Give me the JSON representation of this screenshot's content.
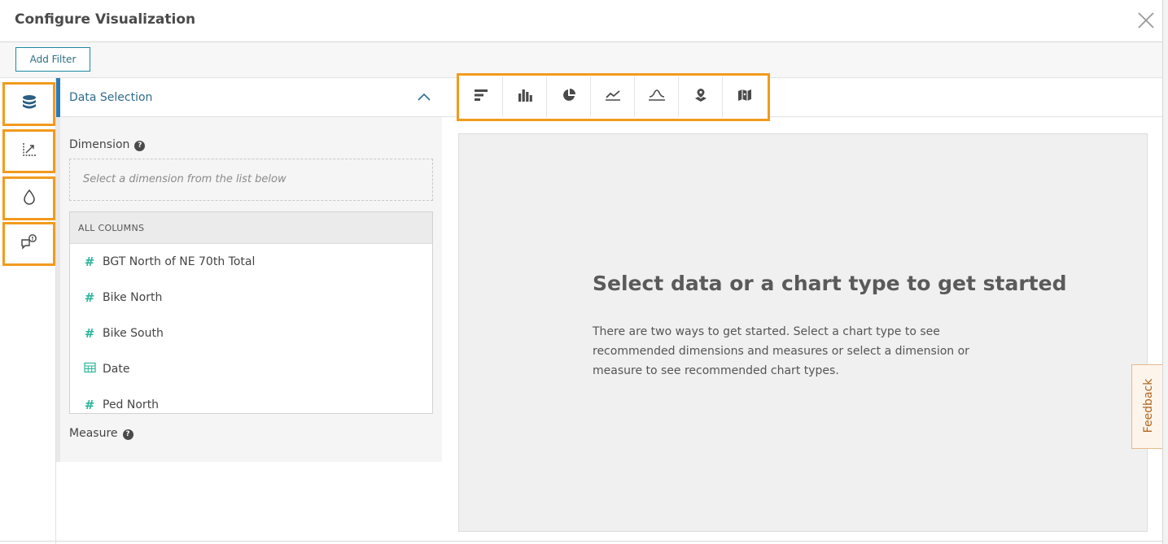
{
  "header": {
    "title": "Configure Visualization"
  },
  "toolbar": {
    "add_filter_label": "Add Filter"
  },
  "left_nav": {
    "items": [
      "database-icon",
      "axis-chart-icon",
      "color-drop-icon",
      "chat-info-icon"
    ]
  },
  "panel": {
    "title": "Data Selection",
    "dimension_label": "Dimension",
    "dimension_placeholder": "Select a dimension from the list below",
    "columns_header": "ALL COLUMNS",
    "columns": [
      {
        "label": "BGT North of NE 70th Total",
        "type": "number"
      },
      {
        "label": "Bike North",
        "type": "number"
      },
      {
        "label": "Bike South",
        "type": "number"
      },
      {
        "label": "Date",
        "type": "calendar"
      },
      {
        "label": "Ped North",
        "type": "number"
      }
    ],
    "measure_label": "Measure"
  },
  "chart_types": [
    "bar-chart-icon",
    "column-chart-icon",
    "pie-chart-icon",
    "timeline-chart-icon",
    "histogram-icon",
    "point-map-icon",
    "region-map-icon"
  ],
  "empty_state": {
    "title": "Select data or a chart type to get started",
    "text": "There are two ways to get started. Select a chart type to see recommended dimensions and measures or select a dimension or measure to see recommended chart types."
  },
  "feedback": {
    "label": "Feedback"
  },
  "colors": {
    "accent": "#f29b1d",
    "teal": "#1b8a9f",
    "link": "#2f6c8c"
  }
}
